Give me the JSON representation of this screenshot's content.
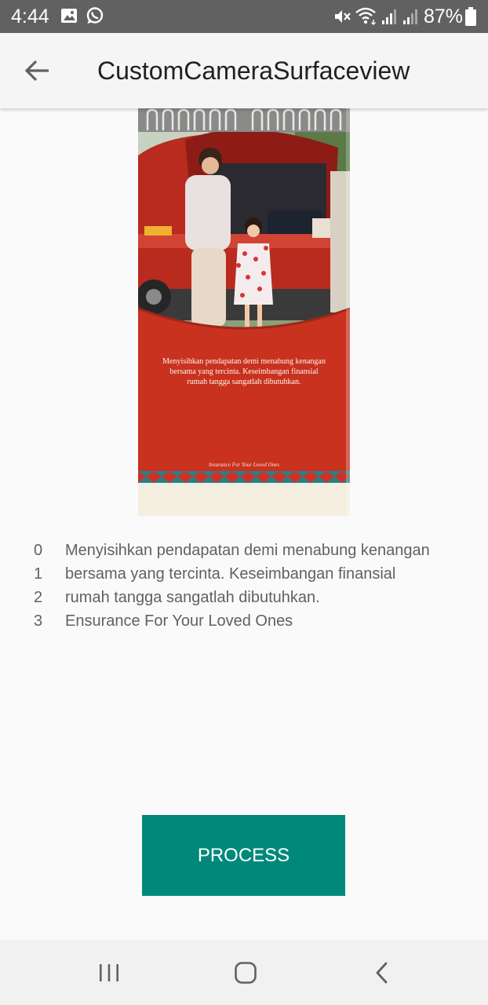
{
  "status_bar": {
    "time": "4:44",
    "battery": "87%",
    "icons": [
      "gallery-icon",
      "whatsapp-icon",
      "mute-icon",
      "wifi-icon",
      "signal-icon",
      "signal-icon",
      "battery-icon"
    ]
  },
  "app_bar": {
    "title": "CustomCameraSurfaceview",
    "back_icon": "arrow-left-icon"
  },
  "photo": {
    "caption_lines": [
      "Menyisihkan pendapatan demi menabung kenangan",
      "bersama yang tercinta. Keseimbangan finansial",
      "rumah tangga sangatlah dibutuhkan."
    ],
    "tagline": "Insurance For Your Loved Ones"
  },
  "results": [
    {
      "index": "0",
      "text": "Menyisihkan pendapatan demi menabung kenangan"
    },
    {
      "index": "1",
      "text": "bersama yang tercinta. Keseimbangan finansial"
    },
    {
      "index": "2",
      "text": "rumah tangga sangatlah dibutuhkan."
    },
    {
      "index": "3",
      "text": "Ensurance For Your Loved Ones"
    }
  ],
  "process_button": {
    "label": "PROCESS",
    "color": "#00897b"
  },
  "nav_bar": {
    "icons": [
      "recents-icon",
      "home-icon",
      "back-icon"
    ]
  }
}
